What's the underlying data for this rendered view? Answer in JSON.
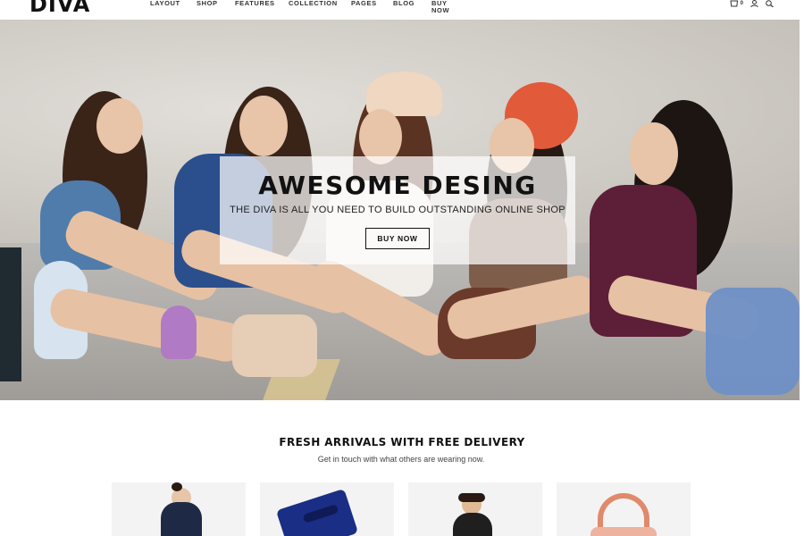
{
  "header": {
    "logo": "DIVA",
    "nav": [
      "LAYOUT",
      "SHOP",
      "FEATURES",
      "COLLECTION",
      "PAGES",
      "BLOG",
      "BUY NOW"
    ],
    "cart_count": "0"
  },
  "hero": {
    "title": "AWESOME DESING",
    "subtitle": "THE DIVA IS ALL YOU NEED TO BUILD OUTSTANDING ONLINE SHOP",
    "button": "BUY NOW"
  },
  "section": {
    "title": "FRESH ARRIVALS WITH FREE DELIVERY",
    "subtitle": "Get in touch with what others are wearing now."
  },
  "colors": {
    "accent": "#111111",
    "overlay": "#ffffff",
    "product_bg": "#f3f3f3"
  },
  "icons": [
    "cart-icon",
    "user-icon",
    "search-icon"
  ]
}
